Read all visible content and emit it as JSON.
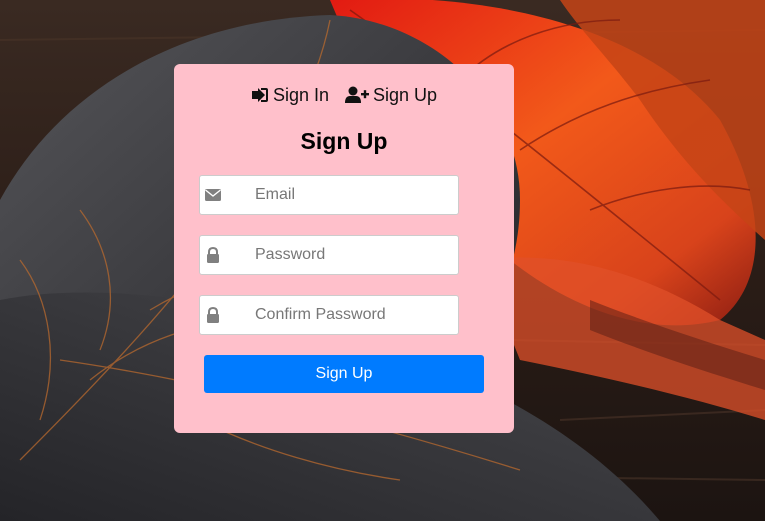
{
  "tabs": {
    "sign_in": {
      "label": "Sign In",
      "icon": "sign-in-icon"
    },
    "sign_up": {
      "label": "Sign Up",
      "icon": "user-plus-icon"
    }
  },
  "form": {
    "title": "Sign Up",
    "email": {
      "placeholder": "Email",
      "value": "",
      "icon": "envelope-icon"
    },
    "password": {
      "placeholder": "Password",
      "value": "",
      "icon": "lock-icon"
    },
    "confirm_password": {
      "placeholder": "Confirm Password",
      "value": "",
      "icon": "lock-icon"
    },
    "submit_label": "Sign Up"
  },
  "colors": {
    "card_background": "#ffc0cb",
    "primary_button": "#007bff",
    "field_border": "#cccccc",
    "icon_color": "#808080"
  }
}
